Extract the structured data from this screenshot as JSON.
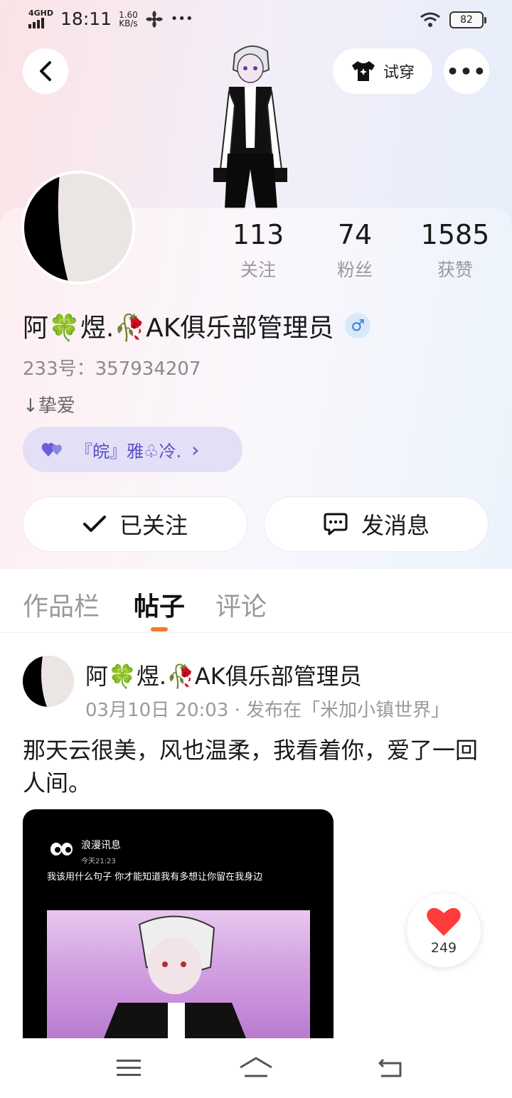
{
  "status_bar": {
    "network": "4GHD",
    "time": "18:11",
    "speed_value": "1.60",
    "speed_unit": "KB/s",
    "dots": "•••",
    "battery": "82"
  },
  "header": {
    "try_on_label": "试穿",
    "more_label": "•••"
  },
  "profile": {
    "stats": [
      {
        "value": "113",
        "label": "关注"
      },
      {
        "value": "74",
        "label": "粉丝"
      },
      {
        "value": "1585",
        "label": "获赞"
      }
    ],
    "username": "阿🍀煜.🥀AK俱乐部管理员",
    "gender_symbol": "♂",
    "uid": "233号：357934207",
    "bio": "↓挚爱",
    "club_label": "『皖』雅♧冷.",
    "club_chevron": "›",
    "follow_label": "已关注",
    "message_label": "发消息"
  },
  "tabs": [
    {
      "label": "作品栏",
      "active": false
    },
    {
      "label": "帖子",
      "active": true
    },
    {
      "label": "评论",
      "active": false
    }
  ],
  "post": {
    "author": "阿🍀煜.🥀AK俱乐部管理员",
    "meta": "03月10日 20:03 · 发布在「米加小镇世界」",
    "text": "那天云很美，风也温柔，我看着你，爱了一回人间。",
    "image": {
      "sender": "浪漫讯息",
      "time": "今天21:23",
      "message": "我该用什么句子  你才能知道我有多想让你留在我身边"
    },
    "likes": "249"
  },
  "colors": {
    "accent": "#ef7b2c",
    "club_bg": "#e2dff6",
    "club_text": "#5a4fc8",
    "like_red": "#ff3b3b"
  }
}
